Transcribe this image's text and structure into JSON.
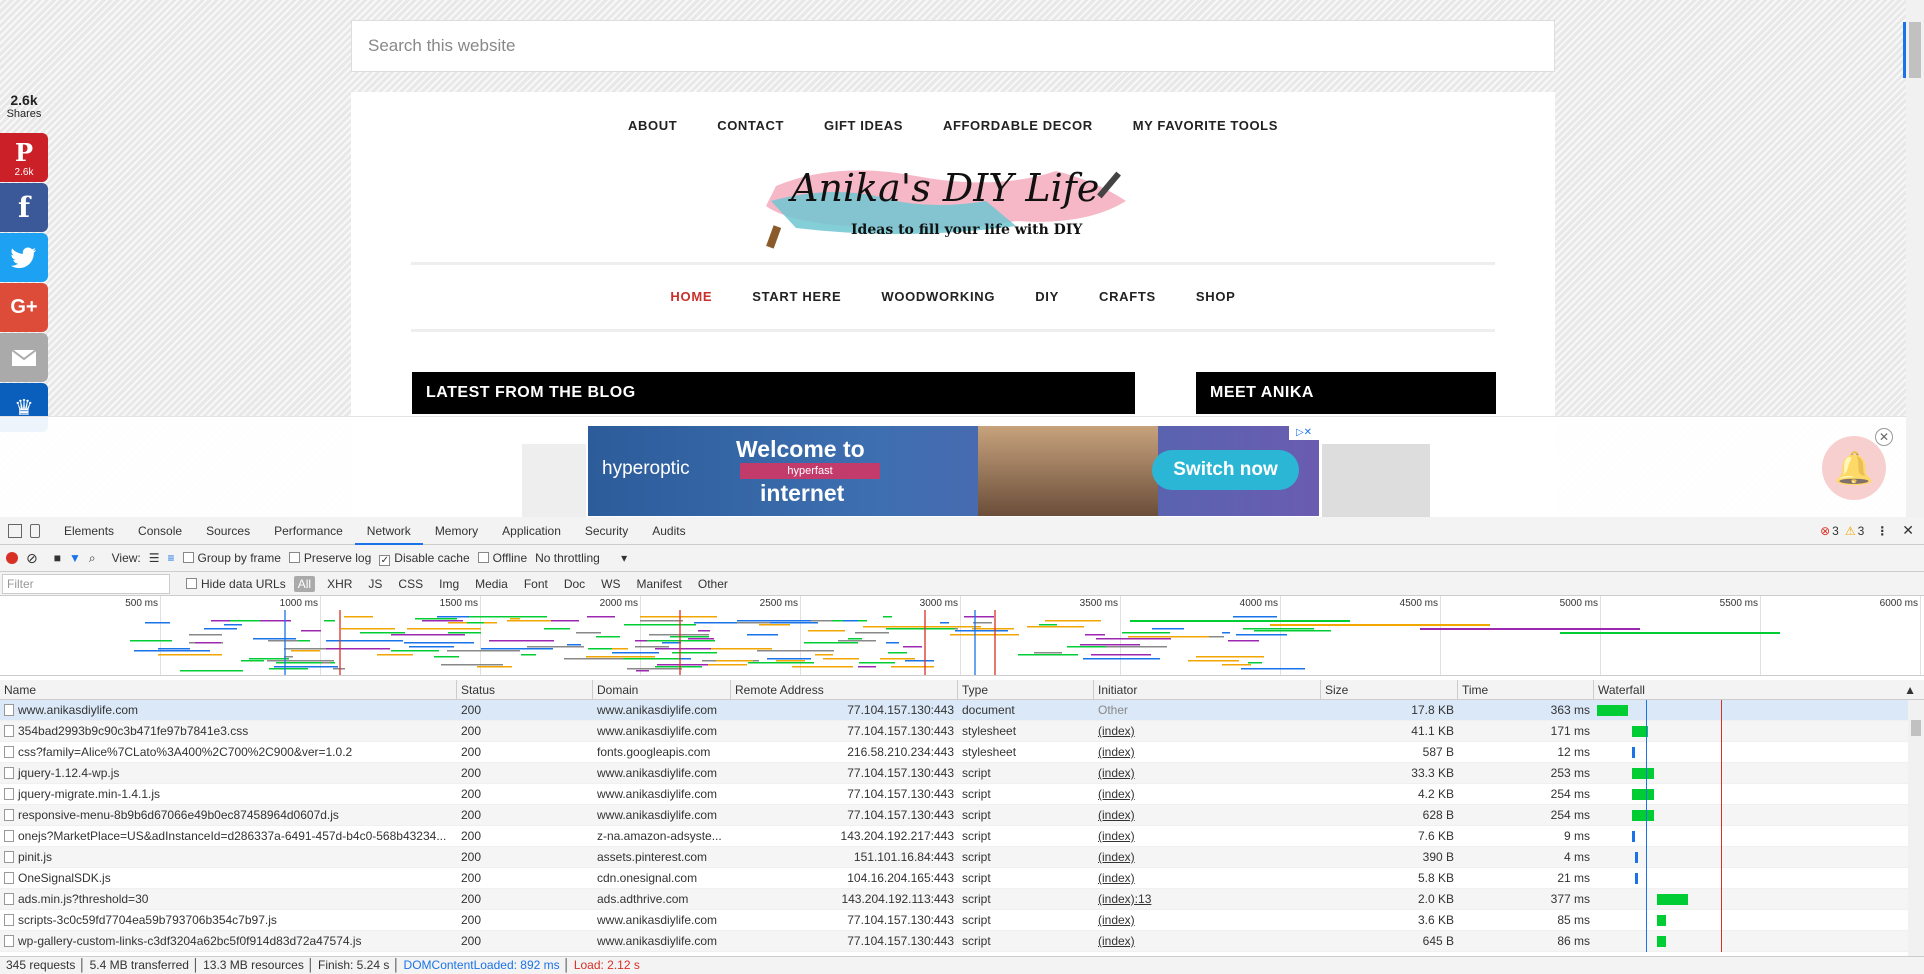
{
  "site": {
    "search_placeholder": "Search this website",
    "top_nav": [
      "ABOUT",
      "CONTACT",
      "GIFT IDEAS",
      "AFFORDABLE DECOR",
      "MY FAVORITE TOOLS"
    ],
    "logo_title": "Anika's DIY Life",
    "logo_tagline": "Ideas to fill your life with DIY",
    "main_nav": [
      {
        "label": "HOME",
        "active": true
      },
      {
        "label": "START HERE",
        "active": false
      },
      {
        "label": "WOODWORKING",
        "active": false
      },
      {
        "label": "DIY",
        "active": false
      },
      {
        "label": "CRAFTS",
        "active": false
      },
      {
        "label": "SHOP",
        "active": false
      }
    ],
    "blog_heading": "LATEST FROM THE BLOG",
    "meet_heading": "MEET ANIKA",
    "share_count": "2.6k",
    "share_label": "Shares",
    "pinterest_count": "2.6k",
    "ad": {
      "brand": "hyperoptic",
      "headline": "Welcome to",
      "sub": "hyperfast",
      "headline2": "internet",
      "cta": "Switch now"
    },
    "colors": {
      "active_nav": "#c9302c",
      "pinterest": "#cb2027",
      "facebook": "#3b5998",
      "twitter": "#1da1f2",
      "google": "#dd4b39",
      "email": "#999999",
      "sumo": "#0a5fbd",
      "cta": "#2cb6d6"
    }
  },
  "devtools": {
    "tabs": [
      "Elements",
      "Console",
      "Sources",
      "Performance",
      "Network",
      "Memory",
      "Application",
      "Security",
      "Audits"
    ],
    "active_tab": "Network",
    "errors": "3",
    "warnings": "3",
    "toolbar": {
      "view": "View:",
      "group_by_frame": "Group by frame",
      "preserve_log": "Preserve log",
      "disable_cache": "Disable cache",
      "offline": "Offline",
      "throttling": "No throttling"
    },
    "filter_placeholder": "Filter",
    "hide_data_urls": "Hide data URLs",
    "filter_types": [
      "All",
      "XHR",
      "JS",
      "CSS",
      "Img",
      "Media",
      "Font",
      "Doc",
      "WS",
      "Manifest",
      "Other"
    ],
    "timeline_ticks": [
      "500 ms",
      "1000 ms",
      "1500 ms",
      "2000 ms",
      "2500 ms",
      "3000 ms",
      "3500 ms",
      "4000 ms",
      "4500 ms",
      "5000 ms",
      "5500 ms",
      "6000 ms"
    ],
    "columns": [
      "Name",
      "Status",
      "Domain",
      "Remote Address",
      "Type",
      "Initiator",
      "Size",
      "Time",
      "Waterfall"
    ],
    "rows": [
      {
        "name": "www.anikasdiylife.com",
        "status": "200",
        "domain": "www.anikasdiylife.com",
        "remote": "77.104.157.130:443",
        "type": "document",
        "initiator": "Other",
        "size": "17.8 KB",
        "time": "363 ms",
        "wf_start": 0.01,
        "wf_len": 0.1
      },
      {
        "name": "354bad2993b9c90c3b471fe97b7841e3.css",
        "status": "200",
        "domain": "www.anikasdiylife.com",
        "remote": "77.104.157.130:443",
        "type": "stylesheet",
        "initiator": "(index)",
        "size": "41.1 KB",
        "time": "171 ms",
        "wf_start": 0.12,
        "wf_len": 0.05
      },
      {
        "name": "css?family=Alice%7CLato%3A400%2C700%2C900&ver=1.0.2",
        "status": "200",
        "domain": "fonts.googleapis.com",
        "remote": "216.58.210.234:443",
        "type": "stylesheet",
        "initiator": "(index)",
        "size": "587 B",
        "time": "12 ms",
        "wf_start": 0.12,
        "wf_len": 0.01
      },
      {
        "name": "jquery-1.12.4-wp.js",
        "status": "200",
        "domain": "www.anikasdiylife.com",
        "remote": "77.104.157.130:443",
        "type": "script",
        "initiator": "(index)",
        "size": "33.3 KB",
        "time": "253 ms",
        "wf_start": 0.12,
        "wf_len": 0.07
      },
      {
        "name": "jquery-migrate.min-1.4.1.js",
        "status": "200",
        "domain": "www.anikasdiylife.com",
        "remote": "77.104.157.130:443",
        "type": "script",
        "initiator": "(index)",
        "size": "4.2 KB",
        "time": "254 ms",
        "wf_start": 0.12,
        "wf_len": 0.07
      },
      {
        "name": "responsive-menu-8b9b6d67066e49b0ec87458964d0607d.js",
        "status": "200",
        "domain": "www.anikasdiylife.com",
        "remote": "77.104.157.130:443",
        "type": "script",
        "initiator": "(index)",
        "size": "628 B",
        "time": "254 ms",
        "wf_start": 0.12,
        "wf_len": 0.07
      },
      {
        "name": "onejs?MarketPlace=US&adInstanceId=d286337a-6491-457d-b4c0-568b43234...",
        "status": "200",
        "domain": "z-na.amazon-adsyste...",
        "remote": "143.204.192.217:443",
        "type": "script",
        "initiator": "(index)",
        "size": "7.6 KB",
        "time": "9 ms",
        "wf_start": 0.12,
        "wf_len": 0.01
      },
      {
        "name": "pinit.js",
        "status": "200",
        "domain": "assets.pinterest.com",
        "remote": "151.101.16.84:443",
        "type": "script",
        "initiator": "(index)",
        "size": "390 B",
        "time": "4 ms",
        "wf_start": 0.13,
        "wf_len": 0.01
      },
      {
        "name": "OneSignalSDK.js",
        "status": "200",
        "domain": "cdn.onesignal.com",
        "remote": "104.16.204.165:443",
        "type": "script",
        "initiator": "(index)",
        "size": "5.8 KB",
        "time": "21 ms",
        "wf_start": 0.13,
        "wf_len": 0.01
      },
      {
        "name": "ads.min.js?threshold=30",
        "status": "200",
        "domain": "ads.adthrive.com",
        "remote": "143.204.192.113:443",
        "type": "script",
        "initiator": "(index):13",
        "size": "2.0 KB",
        "time": "377 ms",
        "wf_start": 0.2,
        "wf_len": 0.1
      },
      {
        "name": "scripts-3c0c59fd7704ea59b793706b354c7b97.js",
        "status": "200",
        "domain": "www.anikasdiylife.com",
        "remote": "77.104.157.130:443",
        "type": "script",
        "initiator": "(index)",
        "size": "3.6 KB",
        "time": "85 ms",
        "wf_start": 0.2,
        "wf_len": 0.03
      },
      {
        "name": "wp-gallery-custom-links-c3df3204a62bc5f0f914d83d72a47574.js",
        "status": "200",
        "domain": "www.anikasdiylife.com",
        "remote": "77.104.157.130:443",
        "type": "script",
        "initiator": "(index)",
        "size": "645 B",
        "time": "86 ms",
        "wf_start": 0.2,
        "wf_len": 0.03
      }
    ],
    "status": {
      "requests": "345 requests",
      "transferred": "5.4 MB transferred",
      "resources": "13.3 MB resources",
      "finish": "Finish: 5.24 s",
      "dcl": "DOMContentLoaded: 892 ms",
      "load": "Load: 2.12 s"
    }
  }
}
